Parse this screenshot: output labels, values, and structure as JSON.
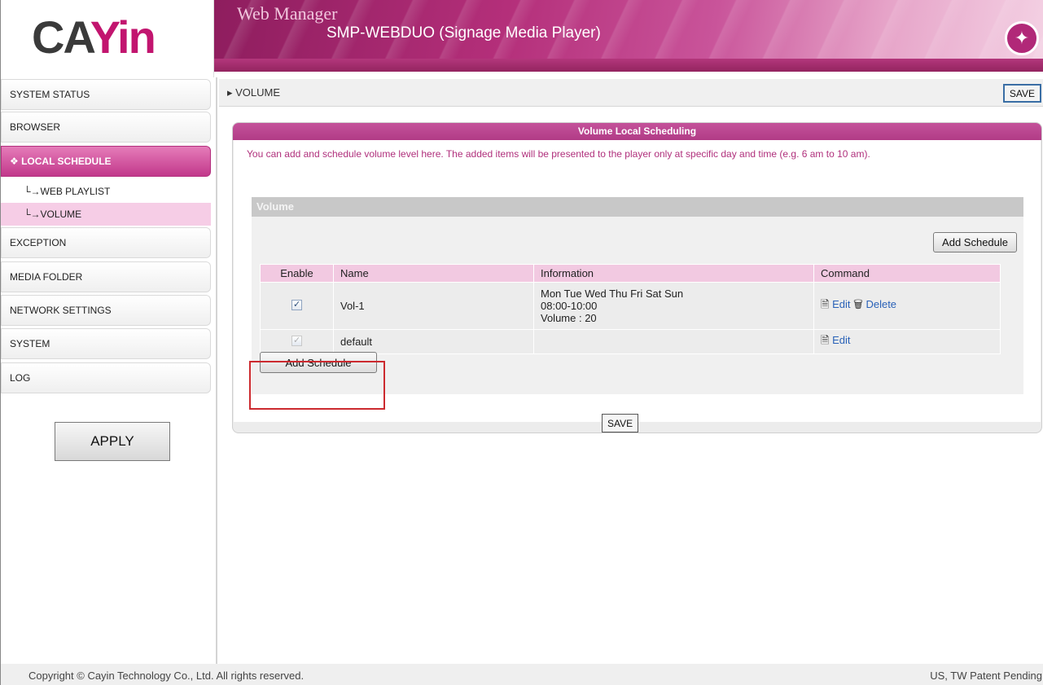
{
  "header": {
    "logo_text_dark": "CA",
    "logo_text_pink": "Yin",
    "app_title": "Web Manager",
    "device_title": "SMP-WEBDUO (Signage Media Player)",
    "badge_icon": "wand-star-icon"
  },
  "sidebar": {
    "items": [
      {
        "label": "SYSTEM STATUS"
      },
      {
        "label": "BROWSER"
      },
      {
        "label": "LOCAL SCHEDULE",
        "prefix": "❖ "
      },
      {
        "label": "EXCEPTION"
      },
      {
        "label": "MEDIA FOLDER"
      },
      {
        "label": "NETWORK SETTINGS"
      },
      {
        "label": "SYSTEM"
      },
      {
        "label": "LOG"
      }
    ],
    "sub_items": [
      {
        "label": "└→WEB PLAYLIST"
      },
      {
        "label": "└→VOLUME"
      }
    ],
    "apply_label": "APPLY"
  },
  "breadcrumb": {
    "text": "▸ VOLUME",
    "save_label": "SAVE"
  },
  "panel": {
    "title": "Volume Local Scheduling",
    "description": "You can add and schedule volume level here. The added items will be presented to the player only at specific day and time (e.g. 6 am to 10 am).",
    "section_title": "Volume",
    "add_schedule_label": "Add Schedule",
    "save_label": "SAVE",
    "columns": [
      "Enable",
      "Name",
      "Information",
      "Command"
    ],
    "rows": [
      {
        "enabled": true,
        "name": "Vol-1",
        "info_line1": "Mon Tue Wed Thu Fri Sat Sun",
        "info_line2": "08:00-10:00",
        "info_line3": "Volume : 20",
        "edit_label": "Edit",
        "delete_label": "Delete"
      },
      {
        "enabled": true,
        "disabled": true,
        "name": "default",
        "edit_label": "Edit"
      }
    ]
  },
  "footer": {
    "copyright": "Copyright © Cayin Technology Co., Ltd. All rights reserved.",
    "patent": "US, TW Patent Pending"
  },
  "colors": {
    "accent": "#c2388b",
    "description_text": "#b0307c",
    "link": "#2a62b8",
    "highlight": "#cc2a2f"
  }
}
